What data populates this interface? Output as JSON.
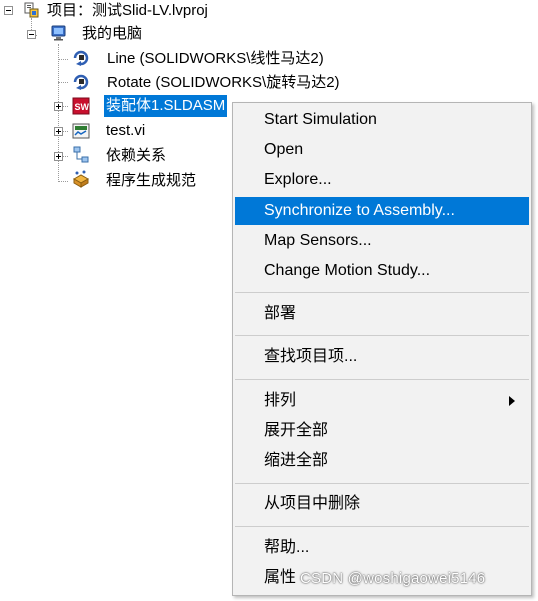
{
  "tree": {
    "project": {
      "label": "项目：测试Slid-LV.lvproj",
      "icon": "project-icon"
    },
    "computer": {
      "label": "我的电脑",
      "icon": "computer-icon"
    },
    "items": [
      {
        "label": "Line (SOLIDWORKS\\线性马达2)",
        "icon": "motor-icon"
      },
      {
        "label": "Rotate (SOLIDWORKS\\旋转马达2)",
        "icon": "motor-icon"
      },
      {
        "label": "装配体1.SLDASM",
        "icon": "solidworks-icon",
        "selected": true
      },
      {
        "label": "test.vi",
        "icon": "vi-icon"
      },
      {
        "label": "依赖关系",
        "icon": "dependencies-icon"
      },
      {
        "label": "程序生成规范",
        "icon": "build-spec-icon"
      }
    ]
  },
  "menu": {
    "items": [
      {
        "label": "Start Simulation"
      },
      {
        "label": "Open"
      },
      {
        "label": "Explore..."
      },
      {
        "label": "Synchronize to Assembly...",
        "highlighted": true
      },
      {
        "label": "Map Sensors..."
      },
      {
        "label": "Change Motion Study..."
      },
      {
        "label": "部署"
      },
      {
        "label": "查找项目项..."
      },
      {
        "label": "排列",
        "submenu": true
      },
      {
        "label": "展开全部"
      },
      {
        "label": "缩进全部"
      },
      {
        "label": "从项目中删除"
      },
      {
        "label": "帮助..."
      },
      {
        "label": "属性"
      }
    ]
  },
  "watermark": "CSDN @woshigaowei5146",
  "colors": {
    "selection": "#0078d7",
    "menu_background": "#f2f2f2"
  }
}
